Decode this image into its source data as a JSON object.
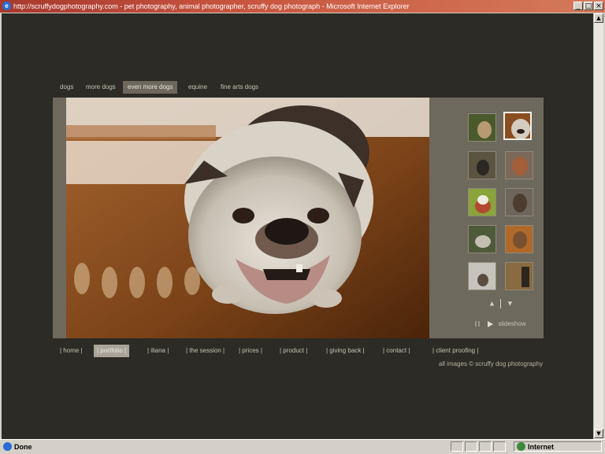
{
  "window": {
    "title": "http://scruffydogphotography.com - pet photography, animal photographer, scruffy dog photograph - Microsoft Internet Explorer",
    "min_label": "_",
    "max_label": "□",
    "close_label": "×"
  },
  "colors": {
    "page_bg": "#2c2b26",
    "panel_bg": "#6e695d",
    "nav_text": "#c9c3b4",
    "titlebar": "#a6392e"
  },
  "top_nav": {
    "items": [
      "dogs",
      "more dogs",
      "even more dogs",
      "equine",
      "fine arts dogs"
    ],
    "active_index": 2
  },
  "thumbnail_arrows": {
    "up": "▲",
    "down": "▼"
  },
  "slideshow": {
    "pause_icon": "pause-icon",
    "play_icon": "play-icon",
    "label": "slideshow"
  },
  "bottom_nav": {
    "items": [
      "| home |",
      "| portfolio |",
      "| iliana |",
      "| the session |",
      "| prices |",
      "| product |",
      "| giving back |",
      "| contact |",
      "| client proofing |"
    ],
    "active_index": 1
  },
  "credit": "all images © scruffy dog photography",
  "status": {
    "text": "Done",
    "zone": "Internet"
  }
}
